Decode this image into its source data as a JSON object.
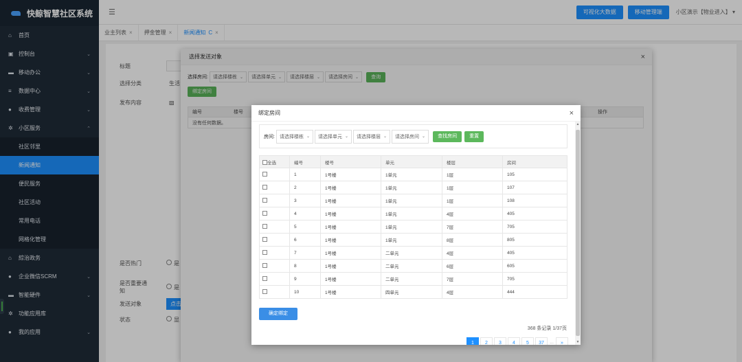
{
  "brand": {
    "title": "快鲸智慧社区系统"
  },
  "sidebar": {
    "items": [
      {
        "icon": "home-icon",
        "glyph": "⌂",
        "label": "首页",
        "chev": ""
      },
      {
        "icon": "dashboard-icon",
        "glyph": "▣",
        "label": "控制台",
        "chev": "⌄"
      },
      {
        "icon": "briefcase-icon",
        "glyph": "▬",
        "label": "移动办公",
        "chev": "⌄"
      },
      {
        "icon": "database-icon",
        "glyph": "≡",
        "label": "数据中心",
        "chev": "⌄"
      },
      {
        "icon": "money-bag-icon",
        "glyph": "●",
        "label": "收费管理",
        "chev": "⌄"
      },
      {
        "icon": "gear-icon",
        "glyph": "✲",
        "label": "小区服务",
        "chev": "⌃"
      },
      {
        "icon": "bank-icon",
        "glyph": "⌂",
        "label": "綜治政务",
        "chev": ""
      },
      {
        "icon": "chat-icon",
        "glyph": "●",
        "label": "企业微信SCRM",
        "chev": "⌄"
      },
      {
        "icon": "hardware-icon",
        "glyph": "▬",
        "label": "智能硬件",
        "chev": "⌄"
      },
      {
        "icon": "app-store-icon",
        "glyph": "✲",
        "label": "功能应用库",
        "chev": ""
      },
      {
        "icon": "user-icon",
        "glyph": "●",
        "label": "我的应用",
        "chev": "⌄"
      }
    ],
    "sub": [
      "社区邻里",
      "新闻通知",
      "便民服务",
      "社区活动",
      "常用电话",
      "网格化管理"
    ]
  },
  "topbar": {
    "bigdata": "可视化大数据",
    "mobile": "移动管理端",
    "user": "小区演示【物业进入】"
  },
  "tabs": [
    {
      "label": "业主列表",
      "close": "×"
    },
    {
      "label": "押金管理",
      "close": "×"
    },
    {
      "label": "新闻通知",
      "close": "×",
      "refresh": "C"
    }
  ],
  "form": {
    "title_label": "标题",
    "category_label": "选择分类",
    "category_value": "生活",
    "content_label": "发布内容",
    "hot_label": "是否热门",
    "hot_opt": "是",
    "important_label": "是否重要通知",
    "important_opt": "是",
    "target_label": "发送对象",
    "target_btn": "点击",
    "status_label": "状态",
    "status_opt": "显"
  },
  "modal1": {
    "title": "选择发送对象",
    "close": "×",
    "room_label": "选择房间:",
    "selects": [
      "请选择楼栋",
      "请选择单元",
      "请选择楼层",
      "请选择房间"
    ],
    "query": "查询",
    "bind_room": "绑定房间",
    "cols": [
      "编号",
      "楼号",
      "操作"
    ],
    "nodata": "没有任何数据。"
  },
  "modal2": {
    "title": "绑定房间",
    "close": "×",
    "room_label": "房间:",
    "selects": [
      "请选择楼栋",
      "请选择单元",
      "请选择楼层",
      "请选择房间"
    ],
    "find_room": "查找房间",
    "reset": "重置",
    "headers": [
      "全选",
      "编号",
      "楼号",
      "单元",
      "楼层",
      "房间"
    ],
    "rows": [
      {
        "no": "1",
        "bld": "1号楼",
        "unit": "1单元",
        "floor": "1层",
        "room": "105"
      },
      {
        "no": "2",
        "bld": "1号楼",
        "unit": "1单元",
        "floor": "1层",
        "room": "107"
      },
      {
        "no": "3",
        "bld": "1号楼",
        "unit": "1单元",
        "floor": "1层",
        "room": "108"
      },
      {
        "no": "4",
        "bld": "1号楼",
        "unit": "1单元",
        "floor": "4层",
        "room": "405"
      },
      {
        "no": "5",
        "bld": "1号楼",
        "unit": "1单元",
        "floor": "7层",
        "room": "705"
      },
      {
        "no": "6",
        "bld": "1号楼",
        "unit": "1单元",
        "floor": "8层",
        "room": "805"
      },
      {
        "no": "7",
        "bld": "1号楼",
        "unit": "二单元",
        "floor": "4层",
        "room": "405"
      },
      {
        "no": "8",
        "bld": "1号楼",
        "unit": "二单元",
        "floor": "6层",
        "room": "605"
      },
      {
        "no": "9",
        "bld": "1号楼",
        "unit": "二单元",
        "floor": "7层",
        "room": "705"
      },
      {
        "no": "10",
        "bld": "1号楼",
        "unit": "四单元",
        "floor": "4层",
        "room": "444"
      }
    ],
    "confirm": "确定绑定",
    "records": "368 条记录 1/37页",
    "pages": [
      "1",
      "2",
      "3",
      "4",
      "5",
      "37",
      "...",
      "»"
    ]
  }
}
